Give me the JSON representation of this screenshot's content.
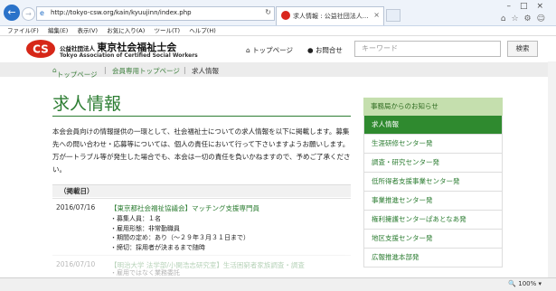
{
  "browser": {
    "url": "http://tokyo-csw.org/kain/kyuujinn/index.php",
    "tab_title": "求人情報 : 公益社団法人...",
    "menu": [
      "ファイル(F)",
      "編集(E)",
      "表示(V)",
      "お気に入り(A)",
      "ツール(T)",
      "ヘルプ(H)"
    ],
    "zoom": "100%"
  },
  "header": {
    "org_prefix": "公益社団法人",
    "org_name": "東京社会福祉士会",
    "org_en": "Tokyo Association of Certified Social Workers",
    "nav_top": "トップページ",
    "nav_contact": "お問合せ",
    "search_placeholder": "キーワード",
    "search_button": "検索"
  },
  "breadcrumb": [
    "トップページ",
    "会員専用トップページ",
    "求人情報"
  ],
  "main": {
    "title": "求人情報",
    "intro": "本会会員向けの情報提供の一環として、社会福祉士についての求人情報を以下に掲載します。募集先への問い合わせ・応募等については、個人の責任において行って下さいますようお願いします。万が一トラブル等が発生した場合でも、本会は一切の責任を負いかねますので、予めご了承ください。",
    "table_header": "（掲載日）",
    "rows": [
      {
        "date": "2016/07/16",
        "title": "【東京都社会福祉協議会】マッチング支援専門員",
        "details": [
          "・募集人員：１名",
          "・雇用形態：非常勤職員",
          "・期間の定め：あり（～２９年３月３１日まで）",
          "・締切：採用者が決まるまで随時"
        ]
      },
      {
        "date": "2016/07/10",
        "title": "【明治大学 法学部/小関浩志研究室】生活困窮者家族調査・調査",
        "details": [
          "・雇用ではなく業務委託"
        ]
      }
    ]
  },
  "sidebar": {
    "heading": "事務局からのお知らせ",
    "items": [
      "求人情報",
      "生涯研修センター発",
      "調査・研究センター発",
      "低所得者支援事業センター発",
      "事業推進センター発",
      "権利擁護センターぱあとなあ発",
      "地区支援センター発",
      "広報推進本部発"
    ]
  },
  "colors": {
    "accent": "#2c7d32",
    "active": "#2f8a2f",
    "sidebar_head": "#c5dfae"
  }
}
